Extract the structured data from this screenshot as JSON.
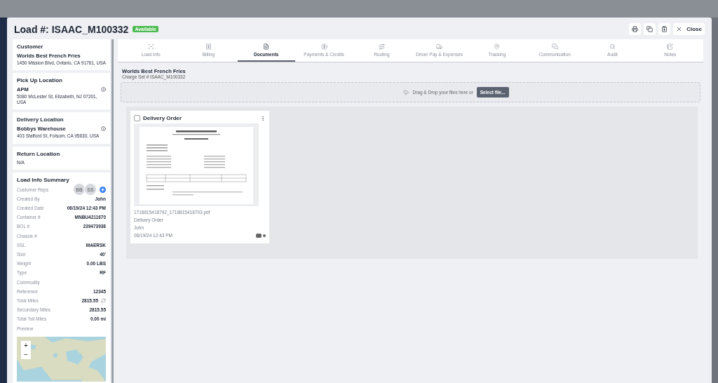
{
  "window": {
    "title": "Load #: ISAAC_M100332",
    "status": "Available"
  },
  "toolbar": {
    "close_label": "Close"
  },
  "sidebar": {
    "customer": {
      "heading": "Customer",
      "name": "Worlds Best French Fries",
      "address": "1450 Mission Blvd, Ontario, CA 91761, USA"
    },
    "pickup": {
      "heading": "Pick Up Location",
      "name": "APM",
      "address": "5080 McLester St, Elizabeth, NJ 07201, USA"
    },
    "delivery": {
      "heading": "Delivery Location",
      "name": "Bobbys Warehouse",
      "address": "403 Stafford St, Folsom, CA 95630, USA"
    },
    "return": {
      "heading": "Return Location",
      "value": "N/A"
    },
    "summary": {
      "heading": "Load Info Summary",
      "reps_label": "Customer Reps",
      "reps": [
        "BB",
        "SS"
      ],
      "fields": [
        {
          "label": "Created By",
          "value": "John"
        },
        {
          "label": "Created Date",
          "value": "06/19/24 12:43 PM"
        },
        {
          "label": "Container #",
          "value": "MNBU4211670"
        },
        {
          "label": "BOL #",
          "value": "239473938"
        },
        {
          "label": "Chassis #"
        },
        {
          "label": "SSL",
          "value": "MAERSK"
        },
        {
          "label": "Size",
          "value": "40'"
        },
        {
          "label": "Weight",
          "value": "0.00 LBS"
        },
        {
          "label": "Type",
          "value": "RF"
        },
        {
          "label": "Commodity"
        },
        {
          "label": "Reference",
          "value": "12345"
        },
        {
          "label": "Total Miles",
          "value": "2815.55",
          "refresh": true
        },
        {
          "label": "Secondary Miles",
          "value": "2815.55"
        },
        {
          "label": "Total Toll Miles",
          "value": "0.00 mi"
        }
      ],
      "preview_label": "Preview",
      "zoom_in": "+",
      "zoom_out": "−"
    }
  },
  "tabs": [
    {
      "label": "Load Info",
      "selected": false
    },
    {
      "label": "Billing",
      "selected": false
    },
    {
      "label": "Documents",
      "selected": true
    },
    {
      "label": "Payments & Credits",
      "selected": false
    },
    {
      "label": "Routing",
      "selected": false
    },
    {
      "label": "Driver Pay & Expenses",
      "selected": false
    },
    {
      "label": "Tracking",
      "selected": false
    },
    {
      "label": "Communication",
      "selected": false
    },
    {
      "label": "Audit",
      "selected": false
    },
    {
      "label": "Notes",
      "selected": false
    }
  ],
  "documents": {
    "customer": "Worlds Best French Fries",
    "charge_set": "Charge Set # ISAAC_M100332",
    "dropzone": {
      "text": "Drag & Drop your files here or",
      "button": "Select file..."
    },
    "cards": [
      {
        "title": "Delivery Order",
        "checked": false,
        "filename": "1718815418792_1718815418793.pdf",
        "type": "Delivery Order",
        "user": "John",
        "date": "06/19/24 12:43 PM"
      }
    ]
  }
}
